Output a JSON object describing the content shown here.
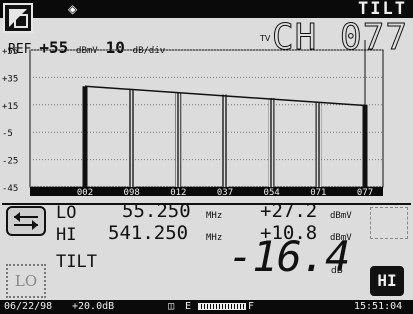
{
  "header": {
    "title": "TILT",
    "channel": "CH 077",
    "tv_label": "TV",
    "ref_label": "REF",
    "ref_value": "+55",
    "ref_unit": "dBmV",
    "scale_value": "10",
    "scale_unit": "dB/div"
  },
  "chart_data": {
    "type": "bar",
    "categories": [
      "002",
      "098",
      "012",
      "037",
      "054",
      "071",
      "077"
    ],
    "values": [
      28.5,
      26,
      24,
      22.5,
      20,
      17,
      15
    ],
    "bar_styles": [
      "solid",
      "hatched",
      "hatched",
      "hatched",
      "hatched",
      "hatched",
      "solid"
    ],
    "tilt_line": [
      28.5,
      14.5
    ],
    "y_ticks": [
      "+55",
      "+35",
      "+15",
      "-5",
      "-25",
      "-45"
    ],
    "y_tick_values": [
      55,
      35,
      15,
      -5,
      -25,
      -45
    ],
    "ylim": [
      -45,
      55
    ],
    "grid": true
  },
  "readout": {
    "lo": {
      "label": "LO",
      "freq": "55.250",
      "freq_unit": "MHz",
      "level": "+27.2",
      "level_unit": "dBmV"
    },
    "hi": {
      "label": "HI",
      "freq": "541.250",
      "freq_unit": "MHz",
      "level": "+10.8",
      "level_unit": "dBmV"
    }
  },
  "tilt": {
    "label": "TILT",
    "value": "-16.4",
    "unit": "dB"
  },
  "buttons": {
    "lo": "LO",
    "hi": "HI"
  },
  "status": {
    "date": "06/22/98",
    "offset": "+20.0dB",
    "battery_e": "E",
    "battery_f": "F",
    "time": "15:51:04"
  }
}
